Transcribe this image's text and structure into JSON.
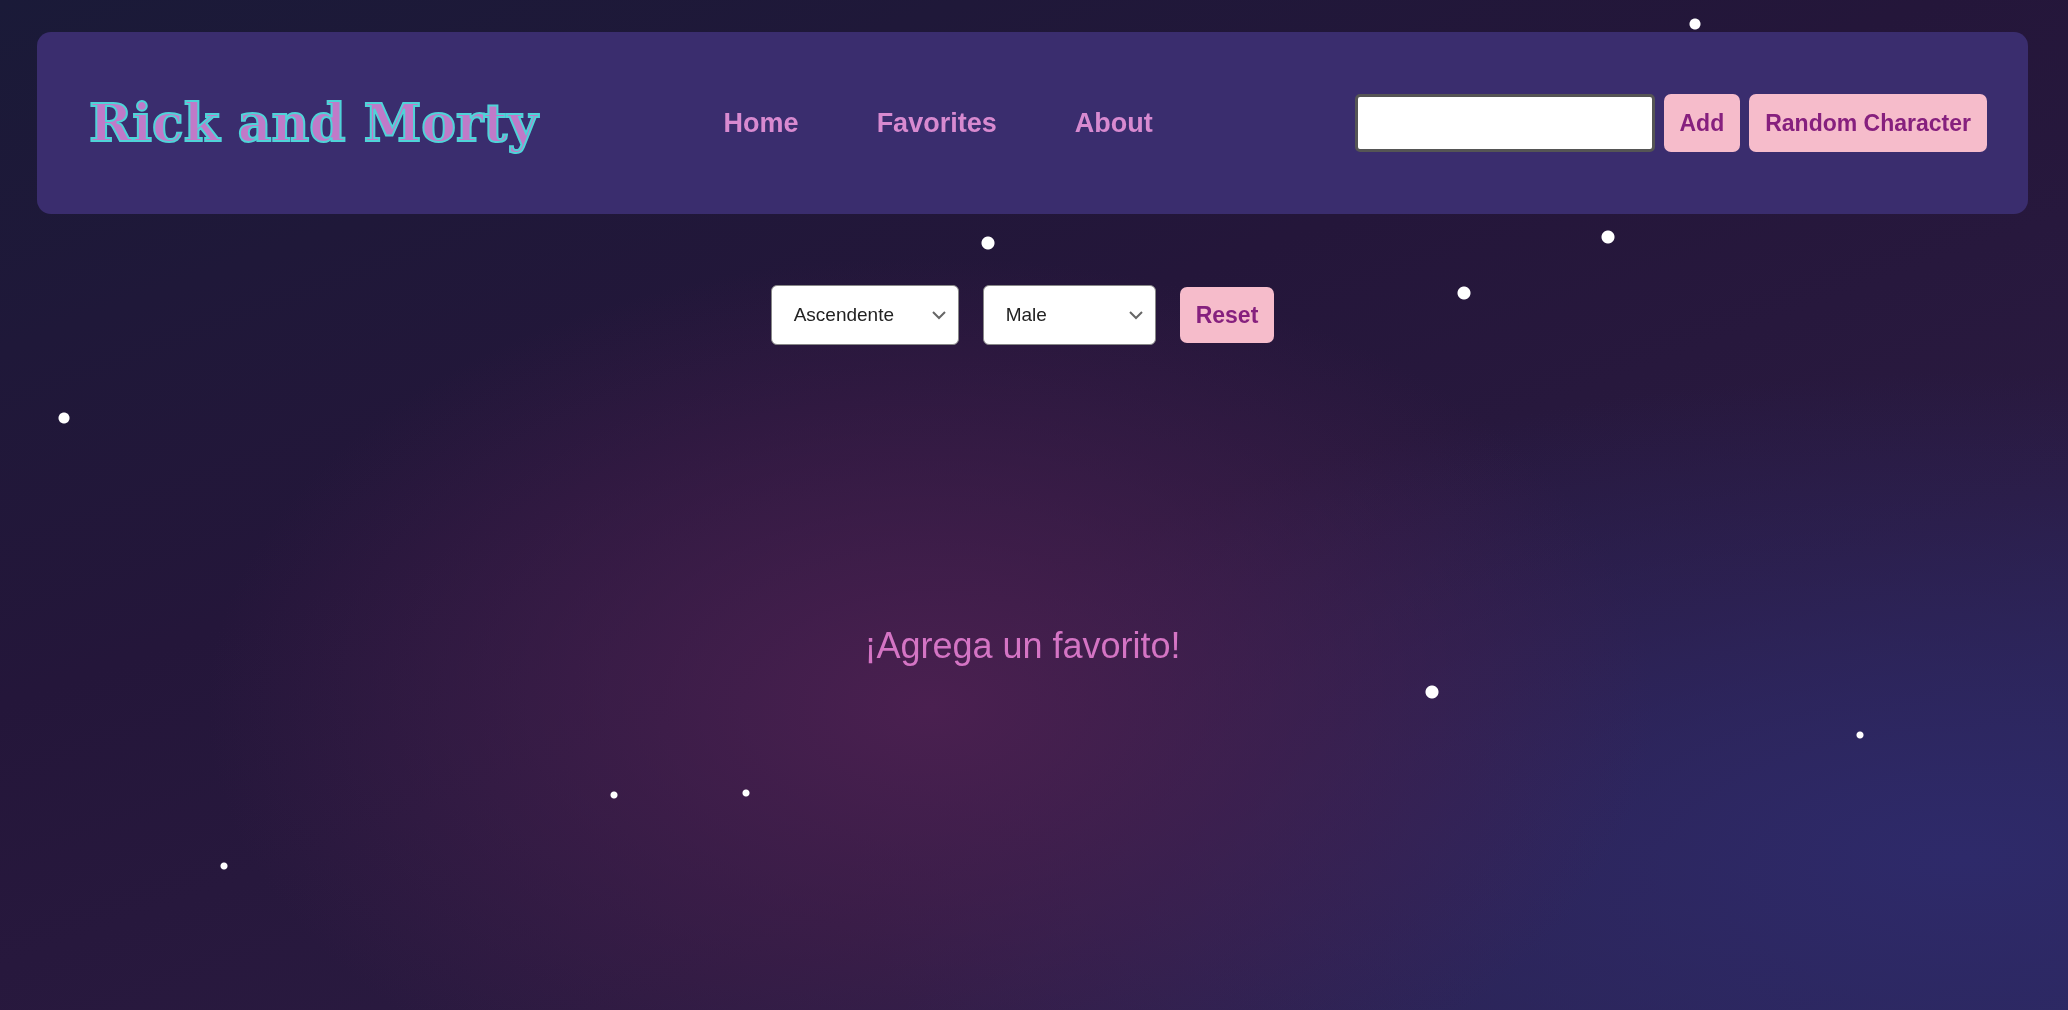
{
  "navbar": {
    "logo": "Rick and Morty",
    "links": [
      {
        "label": "Home"
      },
      {
        "label": "Favorites"
      },
      {
        "label": "About"
      }
    ],
    "buttons": [
      "Add",
      "Random Character"
    ]
  },
  "filters": {
    "order": "Ascendente",
    "gender": "Male",
    "reset": "Reset"
  },
  "message": "¡Agrega un favorito!"
}
